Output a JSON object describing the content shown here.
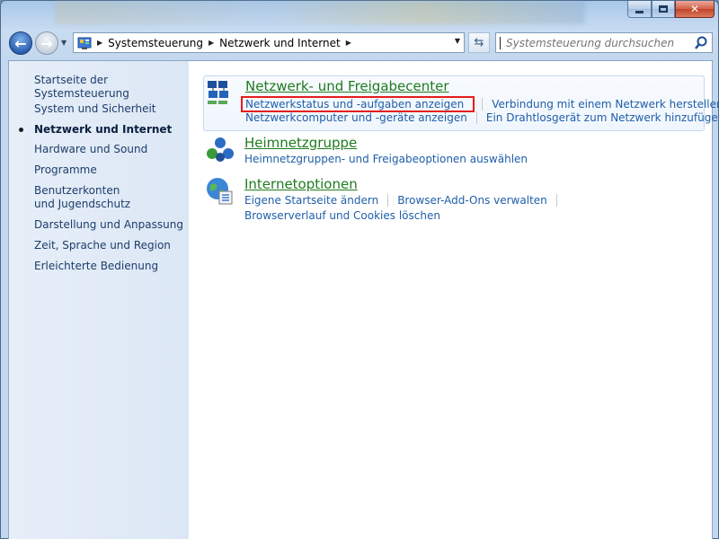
{
  "breadcrumbs": [
    "Systemsteuerung",
    "Netzwerk und Internet"
  ],
  "search": {
    "placeholder": "Systemsteuerung durchsuchen"
  },
  "sidebar": {
    "home": "Startseite der Systemsteuerung",
    "items": [
      {
        "label": "System und Sicherheit"
      },
      {
        "label": "Netzwerk und Internet"
      },
      {
        "label": "Hardware und Sound"
      },
      {
        "label": "Programme"
      },
      {
        "label": "Benutzerkonten und Jugendschutz"
      },
      {
        "label": "Darstellung und Anpassung"
      },
      {
        "label": "Zeit, Sprache und Region"
      },
      {
        "label": "Erleichterte Bedienung"
      }
    ]
  },
  "categories": [
    {
      "title": "Netzwerk- und Freigabecenter",
      "links": [
        "Netzwerkstatus und -aufgaben anzeigen",
        "Verbindung mit einem Netzwerk herstellen",
        "Netzwerkcomputer und -geräte anzeigen",
        "Ein Drahtlosgerät zum Netzwerk hinzufügen"
      ]
    },
    {
      "title": "Heimnetzgruppe",
      "links": [
        "Heimnetzgruppen- und Freigabeoptionen auswählen"
      ]
    },
    {
      "title": "Internetoptionen",
      "links": [
        "Eigene Startseite ändern",
        "Browser-Add-Ons verwalten",
        "Browserverlauf und Cookies löschen"
      ]
    }
  ],
  "colors": {
    "category_title": "#1e7b1e",
    "link": "#1f5ea8",
    "highlight_box": "#e41d1d"
  }
}
